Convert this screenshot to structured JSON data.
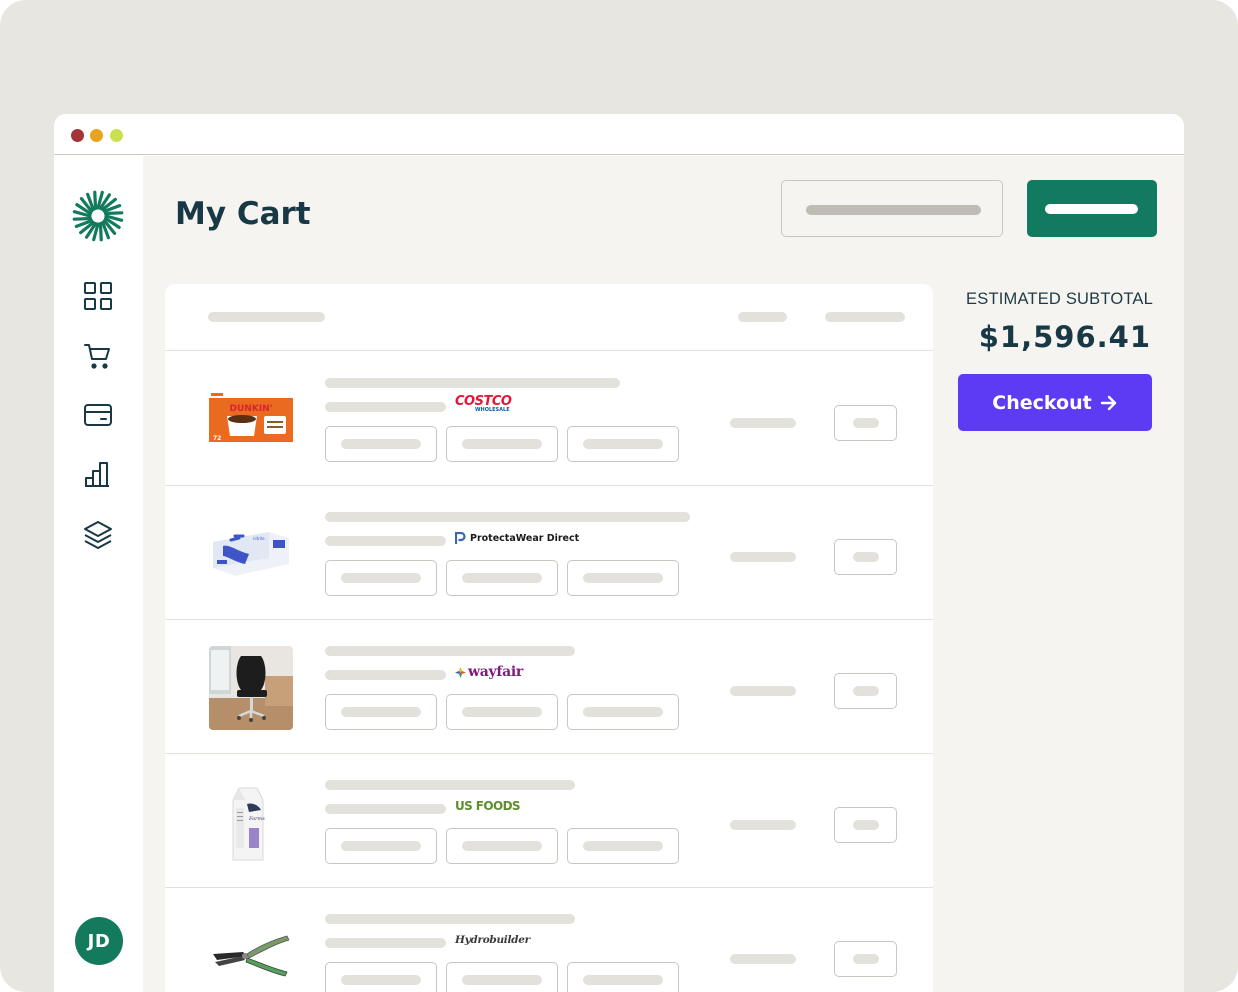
{
  "window": {
    "controls": [
      {
        "name": "close",
        "color": "#a4343a"
      },
      {
        "name": "minimize",
        "color": "#e8a41c"
      },
      {
        "name": "maximize",
        "color": "#c7e24e"
      }
    ]
  },
  "sidebar": {
    "logo_icon": "starburst-logo-icon",
    "nav": [
      {
        "id": "dashboard",
        "icon": "dashboard-grid-icon"
      },
      {
        "id": "cart",
        "icon": "cart-icon"
      },
      {
        "id": "payments",
        "icon": "credit-card-icon"
      },
      {
        "id": "reports",
        "icon": "bar-chart-icon"
      },
      {
        "id": "catalog",
        "icon": "layers-icon"
      }
    ],
    "avatar_initials": "JD"
  },
  "header": {
    "title": "My Cart"
  },
  "cart": {
    "items": [
      {
        "product": "Dunkin' Original Blend K-Cups",
        "vendor": "COSTCO",
        "vendor_sub": "WHOLESALE",
        "image_icon": "coffee-box-image"
      },
      {
        "product": "Nitrile gloves box",
        "vendor": "ProtectaWear Direct",
        "image_icon": "gloves-box-image"
      },
      {
        "product": "Office chair",
        "vendor": "wayfair",
        "image_icon": "office-chair-image"
      },
      {
        "product": "Milk carton",
        "vendor": "US FOODS",
        "image_icon": "milk-carton-image"
      },
      {
        "product": "Pruning shears",
        "vendor": "Hydrobuilder",
        "image_icon": "pruning-shears-image"
      }
    ]
  },
  "summary": {
    "label": "ESTIMATED SUBTOTAL",
    "amount": "$1,596.41",
    "checkout_label": "Checkout",
    "checkout_icon": "arrow-right-icon"
  },
  "colors": {
    "brand_green": "#137a62",
    "checkout_purple": "#5d3bf5",
    "title_navy": "#173844"
  }
}
